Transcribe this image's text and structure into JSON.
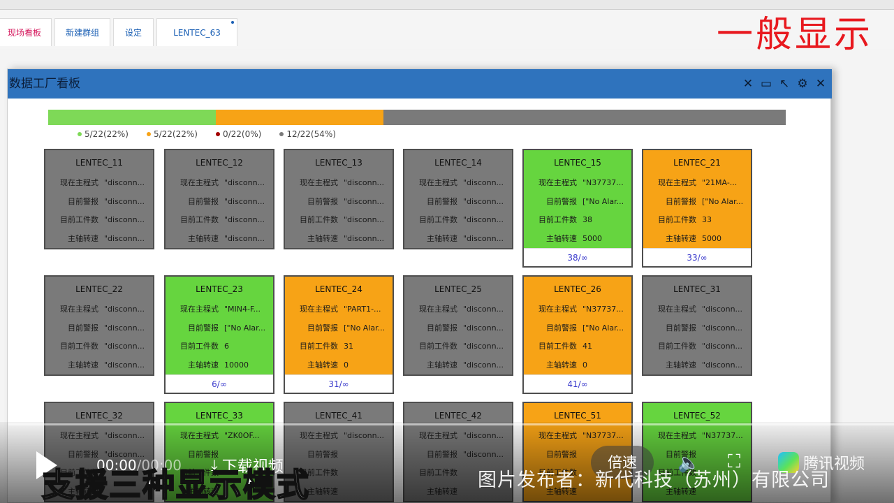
{
  "tabs": [
    {
      "label": "现场看板"
    },
    {
      "label": "新建群组"
    },
    {
      "label": "设定"
    },
    {
      "label": "LENTEC_63"
    }
  ],
  "overlay_label": "一般显示",
  "window": {
    "title": "数据工厂看板",
    "icons": [
      "pin-icon",
      "monitor-icon",
      "arrow-icon",
      "settings-icon",
      "close-icon"
    ]
  },
  "status_summary": {
    "segments": [
      {
        "color": "#7ed957",
        "fraction": 0.2273
      },
      {
        "color": "#f7a316",
        "fraction": 0.2273
      },
      {
        "color": "#7a7a7a",
        "fraction": 0.5454
      }
    ],
    "legend": [
      {
        "color": "#7ed957",
        "label": "5/22(22%)"
      },
      {
        "color": "#f7a316",
        "label": "5/22(22%)"
      },
      {
        "color": "#a30000",
        "label": "0/22(0%)"
      },
      {
        "color": "#7a7a7a",
        "label": "12/22(54%)"
      }
    ]
  },
  "row_labels": [
    "现在主程式",
    "目前警报",
    "目前工件数",
    "主轴转速"
  ],
  "machines": [
    {
      "name": "LENTEC_11",
      "status": "gray",
      "values": [
        "\"disconn...",
        "\"disconn...",
        "\"disconn...",
        "\"disconn..."
      ],
      "footer": null
    },
    {
      "name": "LENTEC_12",
      "status": "gray",
      "values": [
        "\"disconn...",
        "\"disconn...",
        "\"disconn...",
        "\"disconn..."
      ],
      "footer": null
    },
    {
      "name": "LENTEC_13",
      "status": "gray",
      "values": [
        "\"disconn...",
        "\"disconn...",
        "\"disconn...",
        "\"disconn..."
      ],
      "footer": null
    },
    {
      "name": "LENTEC_14",
      "status": "gray",
      "values": [
        "\"disconn...",
        "\"disconn...",
        "\"disconn...",
        "\"disconn..."
      ],
      "footer": null
    },
    {
      "name": "LENTEC_15",
      "status": "green",
      "values": [
        "\"N37737...",
        "[\"No Alar...",
        "38",
        "5000"
      ],
      "footer": "38/∞"
    },
    {
      "name": "LENTEC_21",
      "status": "orange",
      "values": [
        "\"21MA-...",
        "[\"No Alar...",
        "33",
        "5000"
      ],
      "footer": "33/∞"
    },
    {
      "name": "LENTEC_22",
      "status": "gray",
      "values": [
        "\"disconn...",
        "\"disconn...",
        "\"disconn...",
        "\"disconn..."
      ],
      "footer": null
    },
    {
      "name": "LENTEC_23",
      "status": "green",
      "values": [
        "\"MIN4-F...",
        "[\"No Alar...",
        "6",
        "10000"
      ],
      "footer": "6/∞"
    },
    {
      "name": "LENTEC_24",
      "status": "orange",
      "values": [
        "\"PART1-...",
        "[\"No Alar...",
        "31",
        "0"
      ],
      "footer": "31/∞"
    },
    {
      "name": "LENTEC_25",
      "status": "gray",
      "values": [
        "\"disconn...",
        "\"disconn...",
        "\"disconn...",
        "\"disconn..."
      ],
      "footer": null
    },
    {
      "name": "LENTEC_26",
      "status": "orange",
      "values": [
        "\"N37737...",
        "[\"No Alar...",
        "41",
        "0"
      ],
      "footer": "41/∞"
    },
    {
      "name": "LENTEC_31",
      "status": "gray",
      "values": [
        "\"disconn...",
        "\"disconn...",
        "\"disconn...",
        "\"disconn..."
      ],
      "footer": null
    },
    {
      "name": "LENTEC_32",
      "status": "gray",
      "values": [
        "\"disconn...",
        "\"disconn...",
        "",
        ""
      ],
      "footer": null
    },
    {
      "name": "LENTEC_33",
      "status": "green",
      "values": [
        "\"ZK0OF...",
        "",
        "",
        ""
      ],
      "footer": null
    },
    {
      "name": "LENTEC_41",
      "status": "gray",
      "values": [
        "\"disconn...",
        "",
        "",
        ""
      ],
      "footer": null
    },
    {
      "name": "LENTEC_42",
      "status": "gray",
      "values": [
        "\"disconn...",
        "\"disconn...",
        "",
        ""
      ],
      "footer": null
    },
    {
      "name": "LENTEC_51",
      "status": "orange",
      "values": [
        "\"N37737...",
        "",
        "",
        ""
      ],
      "footer": null
    },
    {
      "name": "LENTEC_52",
      "status": "green",
      "values": [
        "\"N37737...",
        "",
        "",
        ""
      ],
      "footer": null
    }
  ],
  "video": {
    "time_current": "00:00",
    "time_total": "00:00",
    "download_label": "下载视频",
    "speed_label": "倍速",
    "brand_label": "腾讯视频",
    "subtitle": "支援三种显示模式",
    "publisher": "图片发布者：新代科技（苏州）有限公司"
  }
}
